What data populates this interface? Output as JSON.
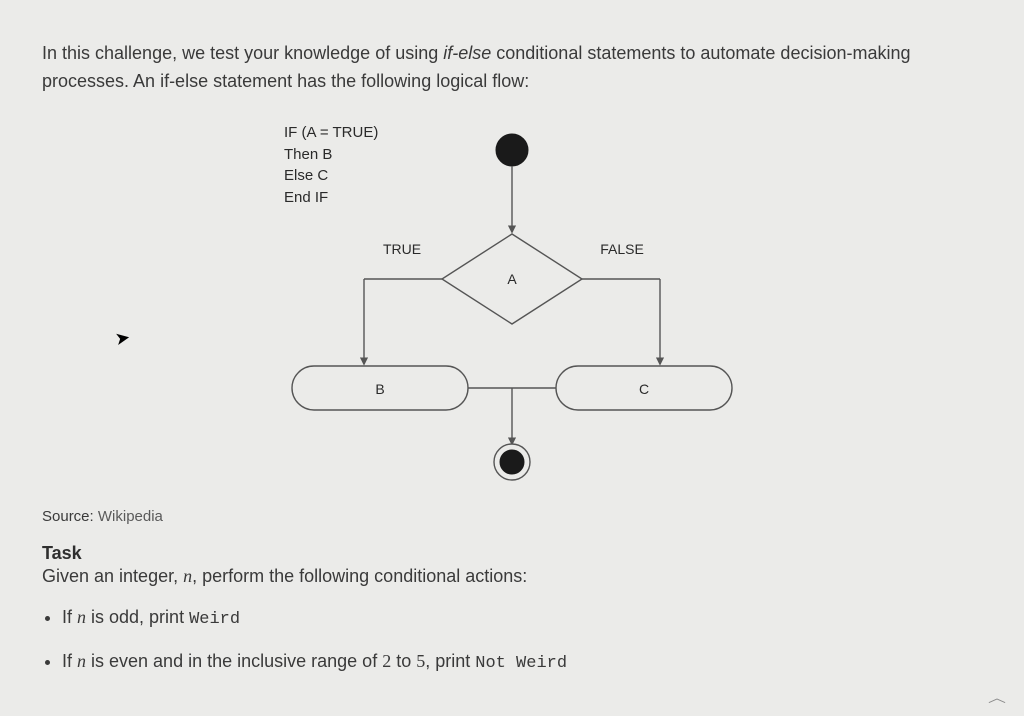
{
  "intro": {
    "pre_em": "In this challenge, we test your knowledge of using ",
    "em": "if-else",
    "post_em": " conditional statements to automate decision-making processes. An if-else statement has the following logical flow:"
  },
  "diagram": {
    "pseudo": {
      "l1": "IF (A = TRUE)",
      "l2": "Then B",
      "l3": "Else C",
      "l4": "End IF"
    },
    "labels": {
      "true": "TRUE",
      "false": "FALSE",
      "cond": "A",
      "left": "B",
      "right": "C"
    }
  },
  "source": {
    "label": "Source: ",
    "link": "Wikipedia"
  },
  "task": {
    "heading": "Task",
    "given_pre": "Given an integer, ",
    "given_var": "n",
    "given_post": ", perform the following conditional actions:",
    "items": [
      {
        "pre": "If ",
        "var": "n",
        "mid": " is odd, print ",
        "code": "Weird"
      },
      {
        "pre": "If ",
        "var": "n",
        "mid": " is even and in the inclusive range of ",
        "r1": "2",
        "r_to": " to ",
        "r2": "5",
        "post_r": ", print ",
        "code": "Not Weird"
      }
    ]
  }
}
